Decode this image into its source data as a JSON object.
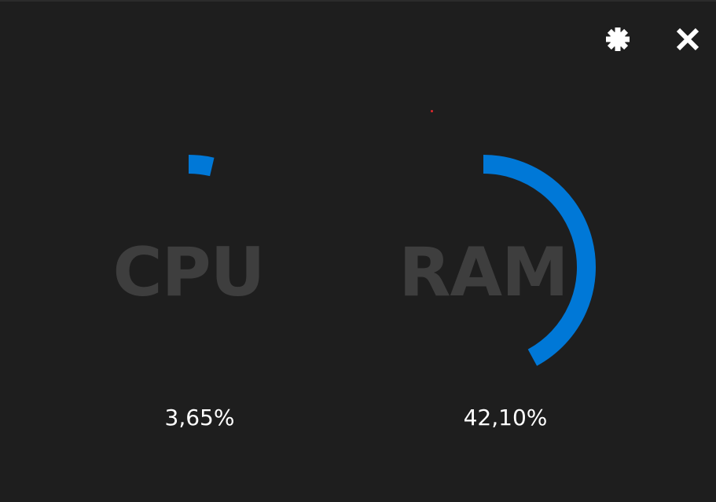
{
  "toolbar": {
    "settings_icon": "gear-icon",
    "close_icon": "close-icon",
    "icon_color": "#ffffff"
  },
  "gauges": [
    {
      "label": "CPU",
      "value_text": "3,65%",
      "value": 3.65,
      "color": "#0078d7"
    },
    {
      "label": "RAM",
      "value_text": "42,10%",
      "value": 42.1,
      "color": "#0078d7"
    }
  ],
  "colors": {
    "background": "#1e1e1e",
    "label": "#3e3e3e",
    "value_text": "#ffffff",
    "indicator": "#e0282e"
  }
}
